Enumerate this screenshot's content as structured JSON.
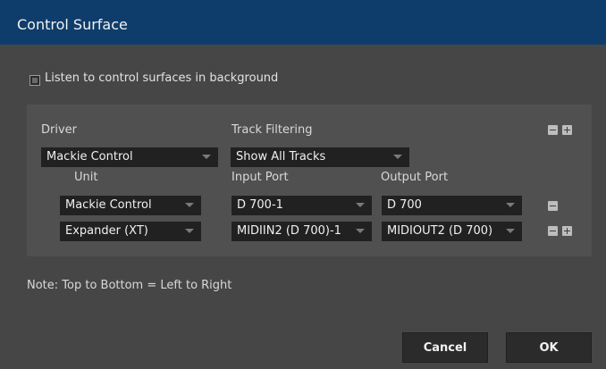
{
  "window": {
    "title": "Control Surface"
  },
  "options": {
    "listen_background_label": "Listen to control surfaces in background",
    "listen_background_checked": false
  },
  "panel": {
    "driver_label": "Driver",
    "driver_value": "Mackie Control",
    "track_filtering_label": "Track Filtering",
    "track_filtering_value": "Show All Tracks",
    "columns": {
      "unit": "Unit",
      "input_port": "Input Port",
      "output_port": "Output Port"
    },
    "rows": [
      {
        "unit": "Mackie Control",
        "input": "D 700-1",
        "output": "D 700"
      },
      {
        "unit": "Expander (XT)",
        "input": "MIDIIN2 (D 700)-1",
        "output": "MIDIOUT2 (D 700)"
      }
    ]
  },
  "note": "Note: Top to Bottom = Left to Right",
  "buttons": {
    "cancel": "Cancel",
    "ok": "OK"
  },
  "icons": {
    "minus": "minus-icon",
    "plus": "plus-icon",
    "dropdown": "chevron-down-icon",
    "checkbox": "checkbox"
  }
}
